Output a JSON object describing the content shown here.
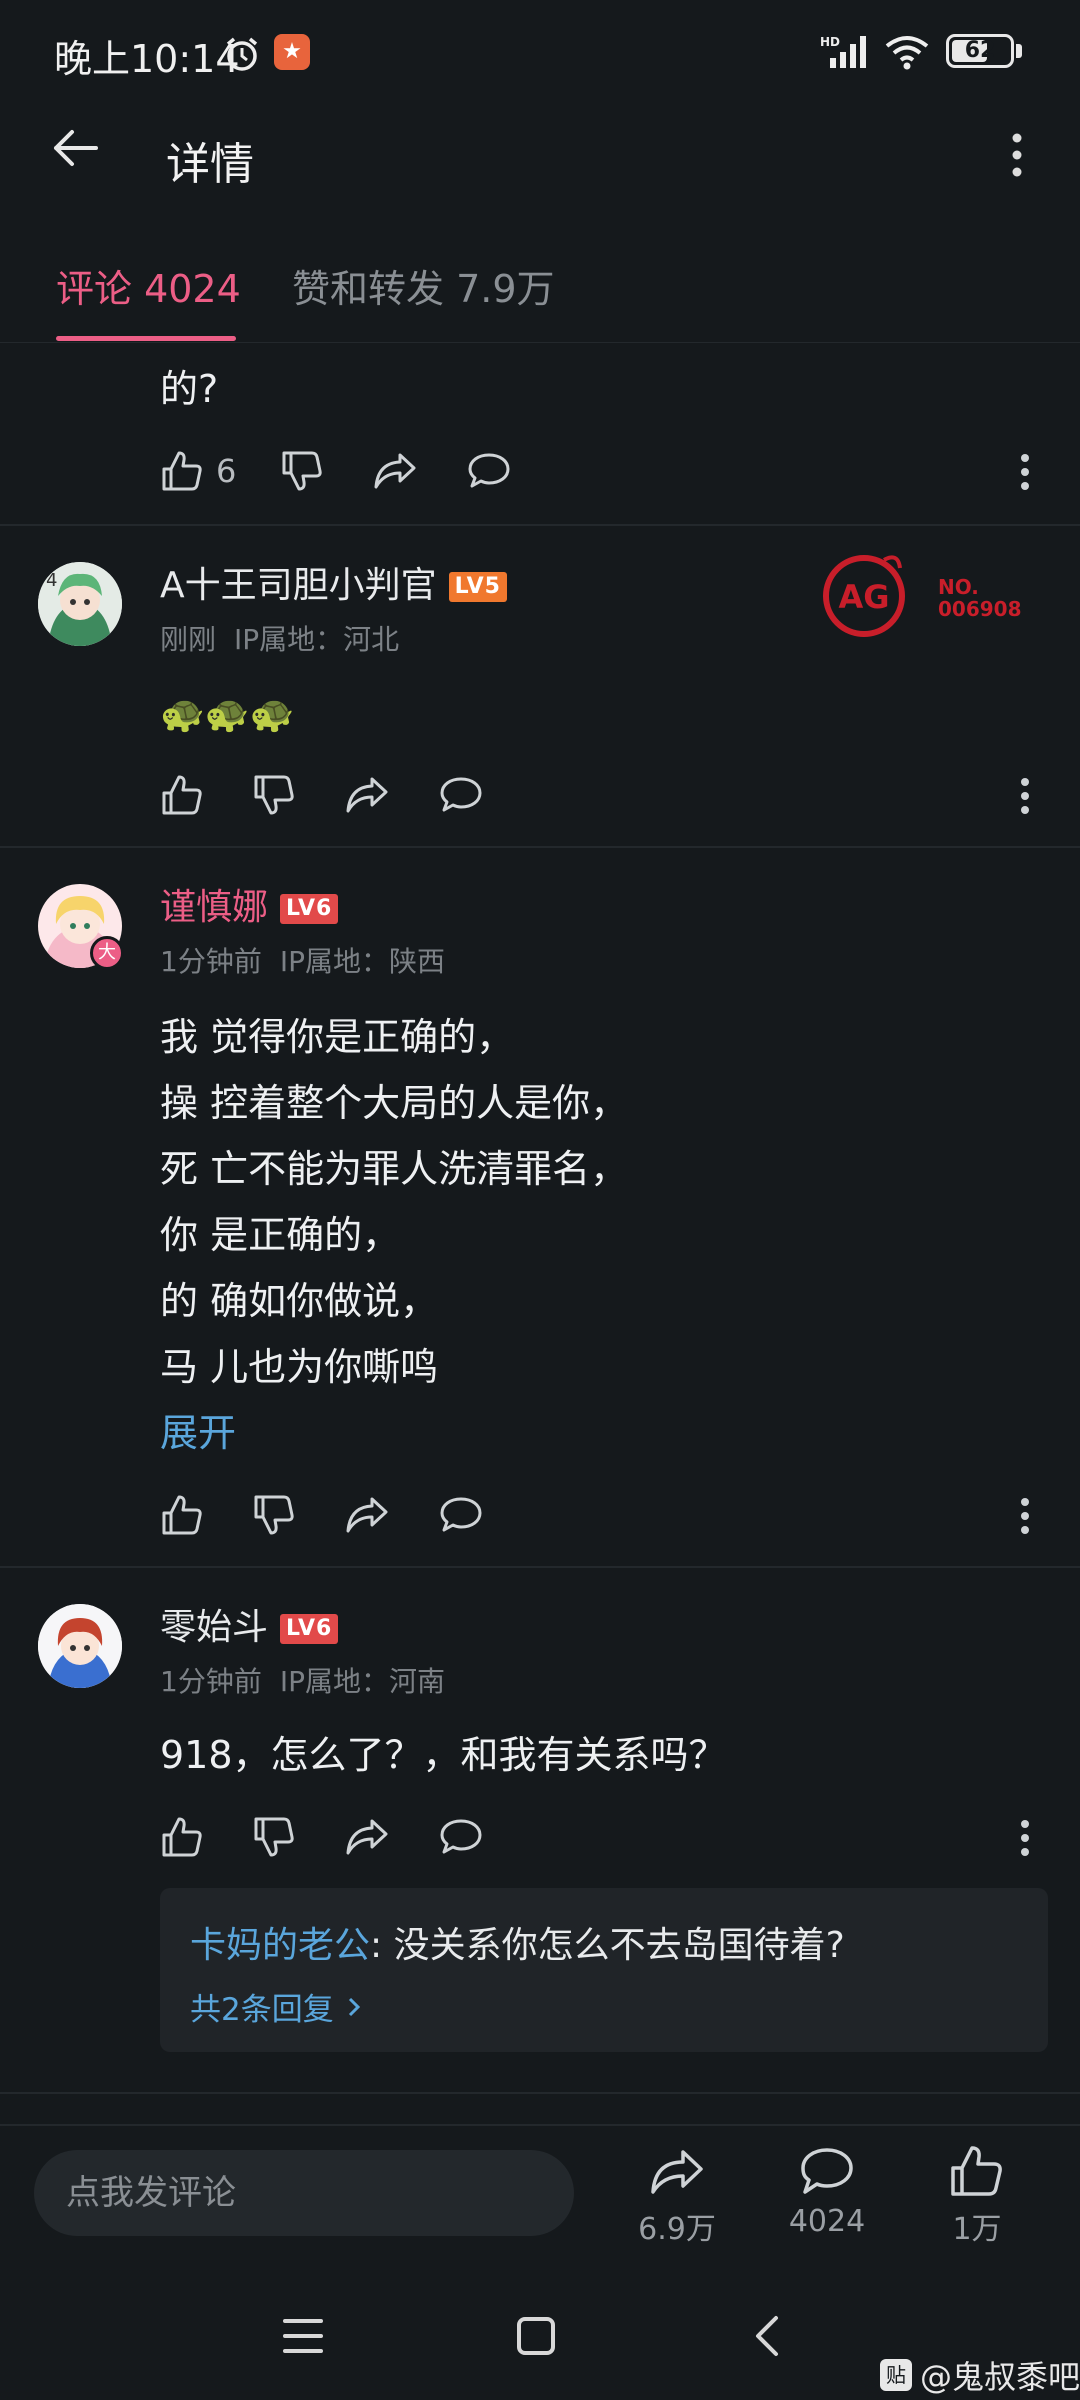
{
  "status_bar": {
    "time": "晚上10:14",
    "app_icon_glyph": "★",
    "battery_level": "62",
    "battery_fraction": 0.62
  },
  "header": {
    "title": "详情"
  },
  "tabs": [
    {
      "label": "评论 4024"
    },
    {
      "label": "赞和转发 7.9万"
    }
  ],
  "comments": [
    {
      "text_tail": "的?",
      "like_count": "6"
    },
    {
      "username": "A十王司胆小判官",
      "level": "LV5",
      "time": "刚刚",
      "ip": "IP属地：河北",
      "text": "🐢🐢🐢",
      "badge_number": "NO.\n006908",
      "badge_logo": "AG"
    },
    {
      "username": "谨慎娜",
      "level": "LV6",
      "time": "1分钟前",
      "ip": "IP属地：陕西",
      "avatar_badge": "大",
      "lines": [
        "我 觉得你是正确的，",
        "操 控着整个大局的人是你，",
        "死 亡不能为罪人洗清罪名，",
        "你 是正确的，",
        "的 确如你做说，",
        "马 儿也为你嘶鸣"
      ],
      "expand_label": "展开"
    },
    {
      "username": "零始斗",
      "level": "LV6",
      "time": "1分钟前",
      "ip": "IP属地：河南",
      "text": "918，怎么了？，和我有关系吗？",
      "reply": {
        "author": "卡妈的老公",
        "text": ": 没关系你怎么不去岛国待着?",
        "more_label": "共2条回复"
      }
    }
  ],
  "bottom_bar": {
    "input_placeholder": "点我发评论",
    "share_count": "6.9万",
    "comment_count": "4024",
    "like_count": "1万"
  },
  "watermark": {
    "logo": "贴",
    "text": "@鬼叔黍吧"
  },
  "colors": {
    "background": "#15191c",
    "accent_pink": "#ec5e86",
    "link_blue": "#5aa6dc",
    "level_badge": "#e24a4a",
    "muted": "#7c8186"
  },
  "icons": {
    "status": [
      "alarm-icon",
      "signal-icon",
      "wifi-icon",
      "battery-icon"
    ],
    "actions": [
      "thumb-up-icon",
      "thumb-down-icon",
      "share-icon",
      "comment-icon",
      "kebab-icon"
    ],
    "nav": [
      "menu-icon",
      "home-icon",
      "back-icon"
    ]
  }
}
